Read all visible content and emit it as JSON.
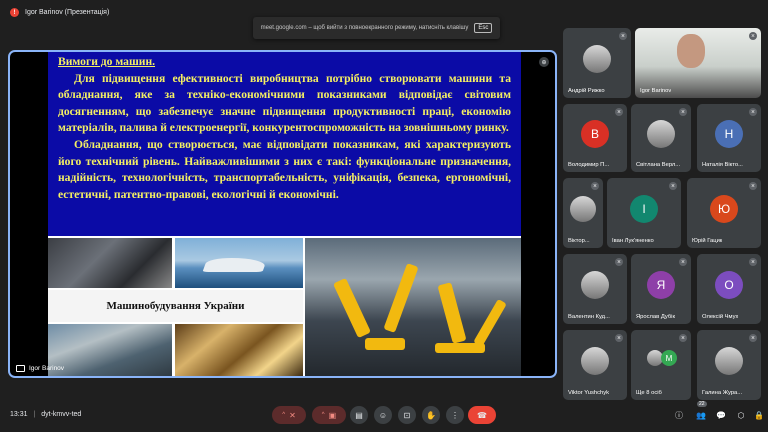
{
  "window": {
    "presenter_badge": "!",
    "presenter_label": "Igor Barinov (Презентація)",
    "banner_text": "meet.google.com – щоб вийти з повноекранного режиму, натисніть клавішу",
    "banner_key": "Esc"
  },
  "slide": {
    "heading": "Вимоги до машин.",
    "paragraph1": "Для підвищення ефективності виробництва потрібно створювати машини та обладнання, яке за техніко-економічними показниками відповідає світовим досягненням, що забезпечує значне підвищення продуктивності праці, економію матеріалів, палива й електроенергії, конкурентоспроможність на зовнішньому ринку.",
    "paragraph2": "Обладнання, що створюється, має відповідати показникам, які характеризують його технічний рівень. Найважливішими з них є такі: функціональне призначення, надійність, технологічність, транспортабельність, уніфікація, безпека, ергономічні, естетичні, патентно-правові, екологічні й економічні.",
    "caption": "Машинобудування України"
  },
  "stage": {
    "presenter_name": "Igor Barinov"
  },
  "participants": [
    {
      "name": "Андрій Рижко",
      "initial": "",
      "color": "#3c4043",
      "type": "photo"
    },
    {
      "name": "Igor Barinov",
      "initial": "",
      "color": "#cfd6d2",
      "type": "video"
    },
    {
      "name": "Володимир П...",
      "initial": "В",
      "color": "#d93025",
      "type": "initial"
    },
    {
      "name": "Світлана Верл...",
      "initial": "",
      "color": "#3c4043",
      "type": "photo"
    },
    {
      "name": "Наталія Вікто...",
      "initial": "Н",
      "color": "#4a6fb5",
      "type": "initial"
    },
    {
      "name": "Віктор...",
      "initial": "",
      "color": "#3c4043",
      "type": "photo"
    },
    {
      "name": "Іван Лук'яненко",
      "initial": "І",
      "color": "#12876f",
      "type": "initial"
    },
    {
      "name": "Юрій Гацик",
      "initial": "Ю",
      "color": "#d9481c",
      "type": "initial"
    },
    {
      "name": "Валентин Куд...",
      "initial": "",
      "color": "#3c4043",
      "type": "photo"
    },
    {
      "name": "Ярослав Дубік",
      "initial": "Я",
      "color": "#8e3fa8",
      "type": "initial"
    },
    {
      "name": "Олексій Чмух",
      "initial": "О",
      "color": "#7c4dbf",
      "type": "initial"
    },
    {
      "name": "Viktor Yushchyk",
      "initial": "",
      "color": "#3c4043",
      "type": "photo"
    },
    {
      "name": "Ще 8 осіб",
      "initial": "M",
      "color": "#3c4043",
      "type": "more"
    },
    {
      "name": "Галина Жура...",
      "initial": "",
      "color": "#3c4043",
      "type": "photo"
    }
  ],
  "bottom": {
    "time": "13:31",
    "meeting_code": "dyt-kmvv-ted",
    "people_count": "22"
  }
}
